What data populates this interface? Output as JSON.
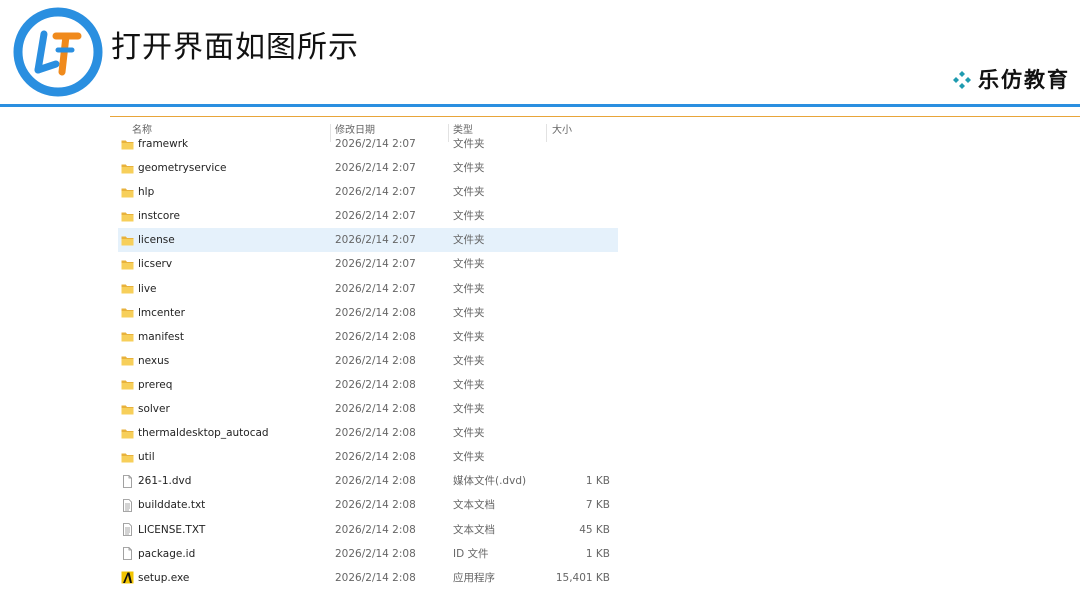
{
  "slide": {
    "title": "打开界面如图所示",
    "brand": "乐仿教育",
    "colors": {
      "accent_blue": "#2a8fe0",
      "accent_orange": "#e8a53a",
      "selection": "#e5f1fb"
    }
  },
  "explorer": {
    "columns": {
      "name": "名称",
      "date": "修改日期",
      "type": "类型",
      "size": "大小"
    },
    "rows": [
      {
        "name": "framewrk",
        "date": "2026/2/14 2:07",
        "type": "文件夹",
        "size": "",
        "icon": "folder-icon"
      },
      {
        "name": "geometryservice",
        "date": "2026/2/14 2:07",
        "type": "文件夹",
        "size": "",
        "icon": "folder-icon"
      },
      {
        "name": "hlp",
        "date": "2026/2/14 2:07",
        "type": "文件夹",
        "size": "",
        "icon": "folder-icon"
      },
      {
        "name": "instcore",
        "date": "2026/2/14 2:07",
        "type": "文件夹",
        "size": "",
        "icon": "folder-icon"
      },
      {
        "name": "license",
        "date": "2026/2/14 2:07",
        "type": "文件夹",
        "size": "",
        "icon": "folder-icon",
        "selected": true
      },
      {
        "name": "licserv",
        "date": "2026/2/14 2:07",
        "type": "文件夹",
        "size": "",
        "icon": "folder-icon"
      },
      {
        "name": "live",
        "date": "2026/2/14 2:07",
        "type": "文件夹",
        "size": "",
        "icon": "folder-icon"
      },
      {
        "name": "lmcenter",
        "date": "2026/2/14 2:08",
        "type": "文件夹",
        "size": "",
        "icon": "folder-icon"
      },
      {
        "name": "manifest",
        "date": "2026/2/14 2:08",
        "type": "文件夹",
        "size": "",
        "icon": "folder-icon"
      },
      {
        "name": "nexus",
        "date": "2026/2/14 2:08",
        "type": "文件夹",
        "size": "",
        "icon": "folder-icon"
      },
      {
        "name": "prereq",
        "date": "2026/2/14 2:08",
        "type": "文件夹",
        "size": "",
        "icon": "folder-icon"
      },
      {
        "name": "solver",
        "date": "2026/2/14 2:08",
        "type": "文件夹",
        "size": "",
        "icon": "folder-icon"
      },
      {
        "name": "thermaldesktop_autocad",
        "date": "2026/2/14 2:08",
        "type": "文件夹",
        "size": "",
        "icon": "folder-icon"
      },
      {
        "name": "util",
        "date": "2026/2/14 2:08",
        "type": "文件夹",
        "size": "",
        "icon": "folder-icon"
      },
      {
        "name": "261-1.dvd",
        "date": "2026/2/14 2:08",
        "type": "媒体文件(.dvd)",
        "size": "1 KB",
        "icon": "file-icon"
      },
      {
        "name": "builddate.txt",
        "date": "2026/2/14 2:08",
        "type": "文本文档",
        "size": "7 KB",
        "icon": "text-file-icon"
      },
      {
        "name": "LICENSE.TXT",
        "date": "2026/2/14 2:08",
        "type": "文本文档",
        "size": "45 KB",
        "icon": "text-file-icon"
      },
      {
        "name": "package.id",
        "date": "2026/2/14 2:08",
        "type": "ID 文件",
        "size": "1 KB",
        "icon": "file-icon"
      },
      {
        "name": "setup.exe",
        "date": "2026/2/14 2:08",
        "type": "应用程序",
        "size": "15,401 KB",
        "icon": "autodesk-setup-icon"
      }
    ]
  }
}
